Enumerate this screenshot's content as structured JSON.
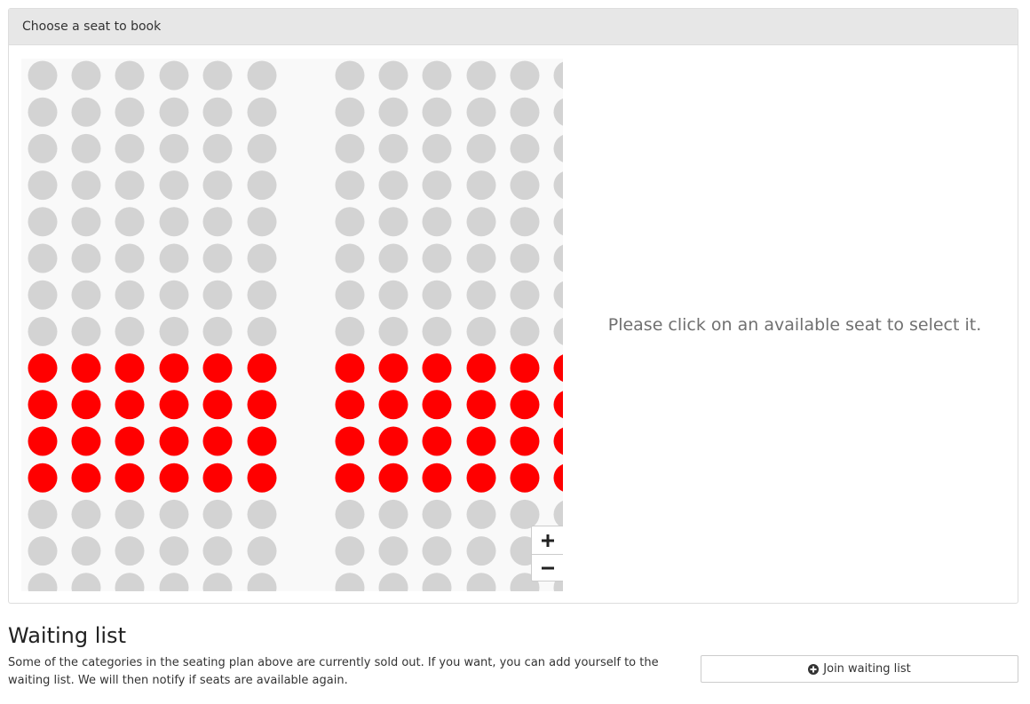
{
  "seating_panel": {
    "heading": "Choose a seat to book",
    "hint": "Please click on an available seat to select it.",
    "seat_colors": {
      "unavailable": "#d3d3d3",
      "highlighted": "#ff0000",
      "map_background": "#f9f9f9"
    },
    "seat_rows": [
      "unavailable",
      "unavailable",
      "unavailable",
      "unavailable",
      "unavailable",
      "unavailable",
      "unavailable",
      "unavailable",
      "highlighted",
      "highlighted",
      "highlighted",
      "highlighted",
      "unavailable",
      "unavailable",
      "unavailable"
    ],
    "zoom_in_icon": "plus-icon",
    "zoom_out_icon": "minus-icon"
  },
  "waiting_list": {
    "title": "Waiting list",
    "description": "Some of the categories in the seating plan above are currently sold out. If you want, you can add yourself to the waiting list. We will then notify if seats are available again.",
    "button_label": "Join waiting list",
    "button_icon": "plus-circle-icon"
  }
}
